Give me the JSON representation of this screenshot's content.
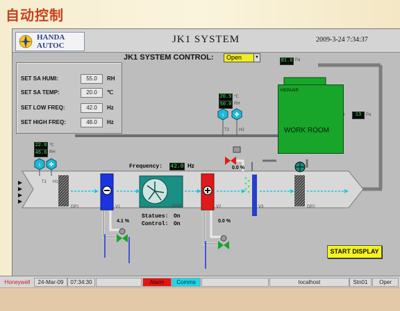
{
  "page_title": "自动控制",
  "header": {
    "logo_line1": "HANDA",
    "logo_line2": "AUTOC",
    "system_title": "JK1 SYSTEM",
    "datetime": "2009-3-24 7:34:37"
  },
  "control": {
    "label": "JK1 SYSTEM CONTROL:",
    "value": "Open"
  },
  "setpoints": [
    {
      "label": "SET SA HUMI:",
      "value": "55.0",
      "unit": "RH"
    },
    {
      "label": "SET SA TEMP:",
      "value": "20.0",
      "unit": "℃"
    },
    {
      "label": "SET LOW FREQ:",
      "value": "42.0",
      "unit": "Hz"
    },
    {
      "label": "SET HIGH FREQ:",
      "value": "48.0",
      "unit": "Hz"
    }
  ],
  "sensors": {
    "room_pressure": {
      "value": "81.6",
      "unit": "Pa"
    },
    "diff_pressure": {
      "value": "13",
      "unit": "Pa"
    },
    "room_temp": {
      "value": "20.9",
      "unit": "℃"
    },
    "room_humi": {
      "value": "50.0",
      "unit": "RH"
    },
    "t2": "T2",
    "h2": "H2",
    "outside_temp": {
      "value": "22.8",
      "unit": "℃"
    },
    "outside_humi": {
      "value": "46.6",
      "unit": "RH"
    },
    "t1": "T1",
    "h1": "H1"
  },
  "room": {
    "label": "WORK ROOM",
    "hepa": "HEPAAIR"
  },
  "fan": {
    "freq_label": "Frequency:",
    "freq_value": "42.0",
    "freq_unit": "Hz",
    "status_label": "Statues:",
    "status_value": "On",
    "control_label": "Control:",
    "control_value": "On",
    "tag": "VVVF"
  },
  "valves": {
    "v1_open": "4.1",
    "v2_open": "0.0",
    "v3_open": "0.0",
    "unit": "%"
  },
  "tags": {
    "dp1": "DP1",
    "v1": "V1",
    "v2": "V2",
    "v3": "V3",
    "dp2": "DP2"
  },
  "start_button": "START DISPLAY",
  "status_bar": {
    "brand": "Honeywell",
    "date": "24-Mar-09",
    "time": "07:34:30",
    "alarm": "Alarm",
    "comms": "Comms",
    "host": "localhost",
    "station": "Stn01",
    "mode": "Oper"
  },
  "colors": {
    "title": "#c8401b",
    "room": "#17a52a",
    "cooling_coil": "#1a34e0",
    "heating_coil": "#e01a1a",
    "fan": "#1b8f84",
    "digital": "#3df04a",
    "button": "#f5f31e",
    "alarm": "#e51414",
    "comms": "#20d6e8"
  }
}
